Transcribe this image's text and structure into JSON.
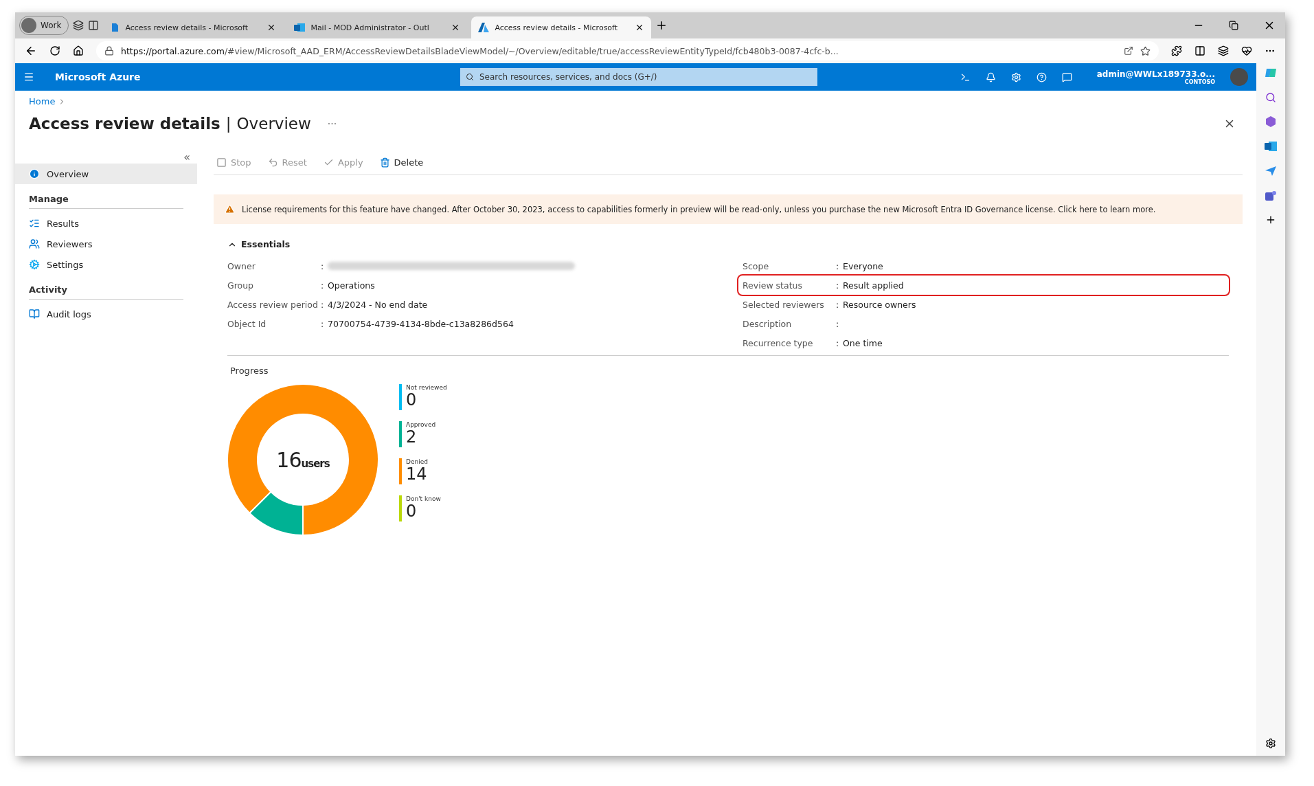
{
  "browser": {
    "profile": "Work",
    "tabs": [
      {
        "title": "Access review details - Microsoft",
        "selected": false,
        "kind": "azure-doc"
      },
      {
        "title": "Mail - MOD Administrator - Outl",
        "selected": false,
        "kind": "outlook"
      },
      {
        "title": "Access review details - Microsoft",
        "selected": true,
        "kind": "azure"
      }
    ],
    "url_host": "https://portal.azure.com",
    "url_path": "/#view/Microsoft_AAD_ERM/AccessReviewDetailsBladeViewModel/~/Overview/editable/true/accessReviewEntityTypeId/fcb480b3-0087-4cfc-b..."
  },
  "portal": {
    "brand": "Microsoft Azure",
    "search": {
      "placeholder": "Search resources, services, and docs (G+/)"
    },
    "user": "admin@WWLx189733.o...",
    "tenant": "CONTOSO"
  },
  "breadcrumb": [
    "Home"
  ],
  "page": {
    "title": "Access review details",
    "separator": "|",
    "subtitle": "Overview",
    "more": "···"
  },
  "sidebar": {
    "collapse": "«",
    "sections": [
      {
        "items": [
          {
            "label": "Overview",
            "selected": true
          }
        ]
      },
      {
        "title": "Manage",
        "items": [
          {
            "label": "Results",
            "selected": false
          },
          {
            "label": "Reviewers",
            "selected": false
          },
          {
            "label": "Settings",
            "selected": false
          }
        ]
      },
      {
        "title": "Activity",
        "items": [
          {
            "label": "Audit logs",
            "selected": false
          }
        ]
      }
    ]
  },
  "toolbar": [
    {
      "label": "Stop",
      "disabled": true
    },
    {
      "label": "Reset",
      "disabled": true
    },
    {
      "label": "Apply",
      "disabled": true
    },
    {
      "label": "Delete",
      "disabled": false
    }
  ],
  "banner": "License requirements for this feature have changed. After October 30, 2023, access to capabilities formerly in preview will be read-only, unless you purchase the new Microsoft Entra ID Governance license. Click here to learn more.",
  "essentials": {
    "title": "Essentials",
    "expanded": true,
    "left": [
      {
        "label": "Owner",
        "separator": ":",
        "redacted": true
      },
      {
        "label": "Group",
        "separator": ":",
        "value": "Operations"
      },
      {
        "label": "Access review period",
        "separator": ":",
        "value": "4/3/2024 - No end date"
      },
      {
        "label": "Object Id",
        "separator": ":",
        "value": "70700754-4739-4134-8bde-c13a8286d564"
      }
    ],
    "right": [
      {
        "label": "Scope",
        "separator": ":",
        "value": "Everyone"
      },
      {
        "label": "Review status",
        "separator": ":",
        "value": "Result applied",
        "highlighted": true
      },
      {
        "label": "Selected reviewers",
        "separator": ":",
        "value": "Resource owners"
      },
      {
        "label": "Description",
        "separator": ":"
      },
      {
        "label": "Recurrence type",
        "separator": ":",
        "value": "One time"
      }
    ]
  },
  "progress": {
    "title": "Progress",
    "total": "16",
    "legend": [
      {
        "count": "0",
        "color": "#00bcf2"
      },
      {
        "count": "2",
        "color": "#00b294"
      },
      {
        "count": "14",
        "color": "#ff8c00"
      },
      {
        "count": "0",
        "color": "#bad80a"
      }
    ],
    "chart_data": {
      "type": "donut",
      "categories": [
        "Not reviewed",
        "Approved",
        "Denied",
        "Don't know"
      ],
      "series": [
        {
          "name": "users",
          "values": [
            0,
            12.5,
            87.5,
            0
          ]
        }
      ]
    }
  }
}
